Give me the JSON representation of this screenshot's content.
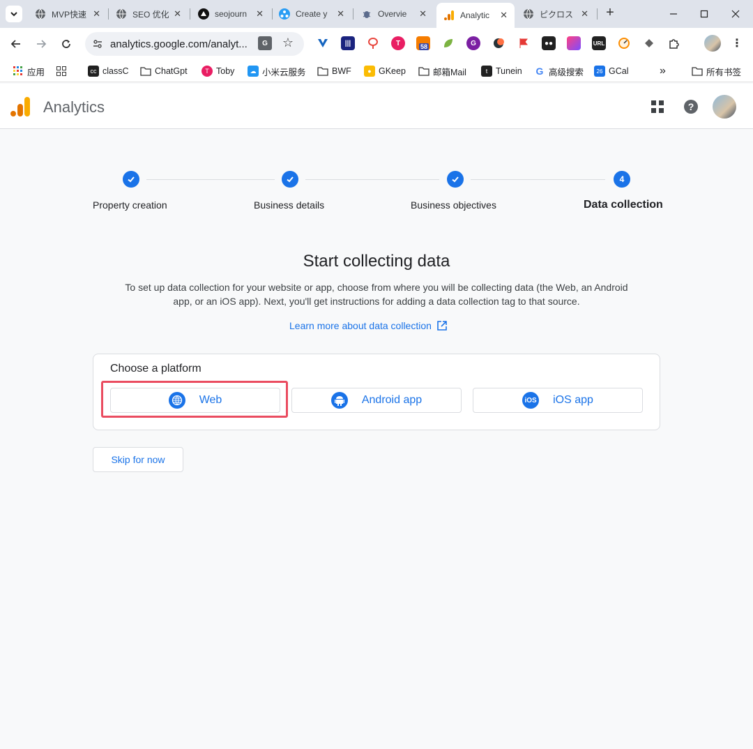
{
  "browser": {
    "tabs": [
      {
        "title": "MVP快速",
        "icon": "globe-icon"
      },
      {
        "title": "SEO 优化",
        "icon": "globe-icon"
      },
      {
        "title": "seojourn",
        "icon": "triangle-logo-icon"
      },
      {
        "title": "Create y",
        "icon": "network-icon"
      },
      {
        "title": "Overvie",
        "icon": "bug-icon"
      },
      {
        "title": "Analytic",
        "icon": "analytics-icon",
        "active": true
      },
      {
        "title": "ピクロス",
        "icon": "globe-icon"
      }
    ],
    "url": "analytics.google.com/analyt...",
    "bookmarks": [
      {
        "label": "应用",
        "icon": "apps-grid-icon"
      },
      {
        "label": "",
        "icon": "grid-icon"
      },
      {
        "label": "classC",
        "icon": "classc-icon"
      },
      {
        "label": "ChatGpt",
        "icon": "folder-icon"
      },
      {
        "label": "Toby",
        "icon": "toby-icon"
      },
      {
        "label": "小米云服务",
        "icon": "cloud-icon"
      },
      {
        "label": "BWF",
        "icon": "folder-icon"
      },
      {
        "label": "GKeep",
        "icon": "keep-icon"
      },
      {
        "label": "邮箱Mail",
        "icon": "folder-icon"
      },
      {
        "label": "Tunein",
        "icon": "tunein-icon"
      },
      {
        "label": "高级搜索",
        "icon": "google-icon"
      },
      {
        "label": "GCal",
        "icon": "calendar-icon",
        "badge": "26"
      }
    ],
    "bookmarks_overflow": "»",
    "all_bookmarks": "所有书签",
    "ext_badge": "58",
    "ext_url_label": "URL"
  },
  "header": {
    "app_name": "Analytics"
  },
  "stepper": {
    "steps": [
      {
        "label": "Property creation",
        "state": "done"
      },
      {
        "label": "Business details",
        "state": "done"
      },
      {
        "label": "Business objectives",
        "state": "done"
      },
      {
        "label": "Data collection",
        "state": "active",
        "number": "4"
      }
    ]
  },
  "main": {
    "title": "Start collecting data",
    "description": "To set up data collection for your website or app, choose from where you will be collecting data (the Web, an Android app, or an iOS app). Next, you'll get instructions for adding a data collection tag to that source.",
    "learn_more": "Learn more about data collection",
    "platform_card_title": "Choose a platform",
    "platforms": [
      {
        "label": "Web",
        "icon": "globe-icon"
      },
      {
        "label": "Android app",
        "icon": "android-icon"
      },
      {
        "label": "iOS app",
        "icon": "ios-icon",
        "icon_text": "iOS"
      }
    ],
    "skip_label": "Skip for now"
  },
  "colors": {
    "accent": "#1a73e8",
    "highlight": "#ea4c60"
  }
}
